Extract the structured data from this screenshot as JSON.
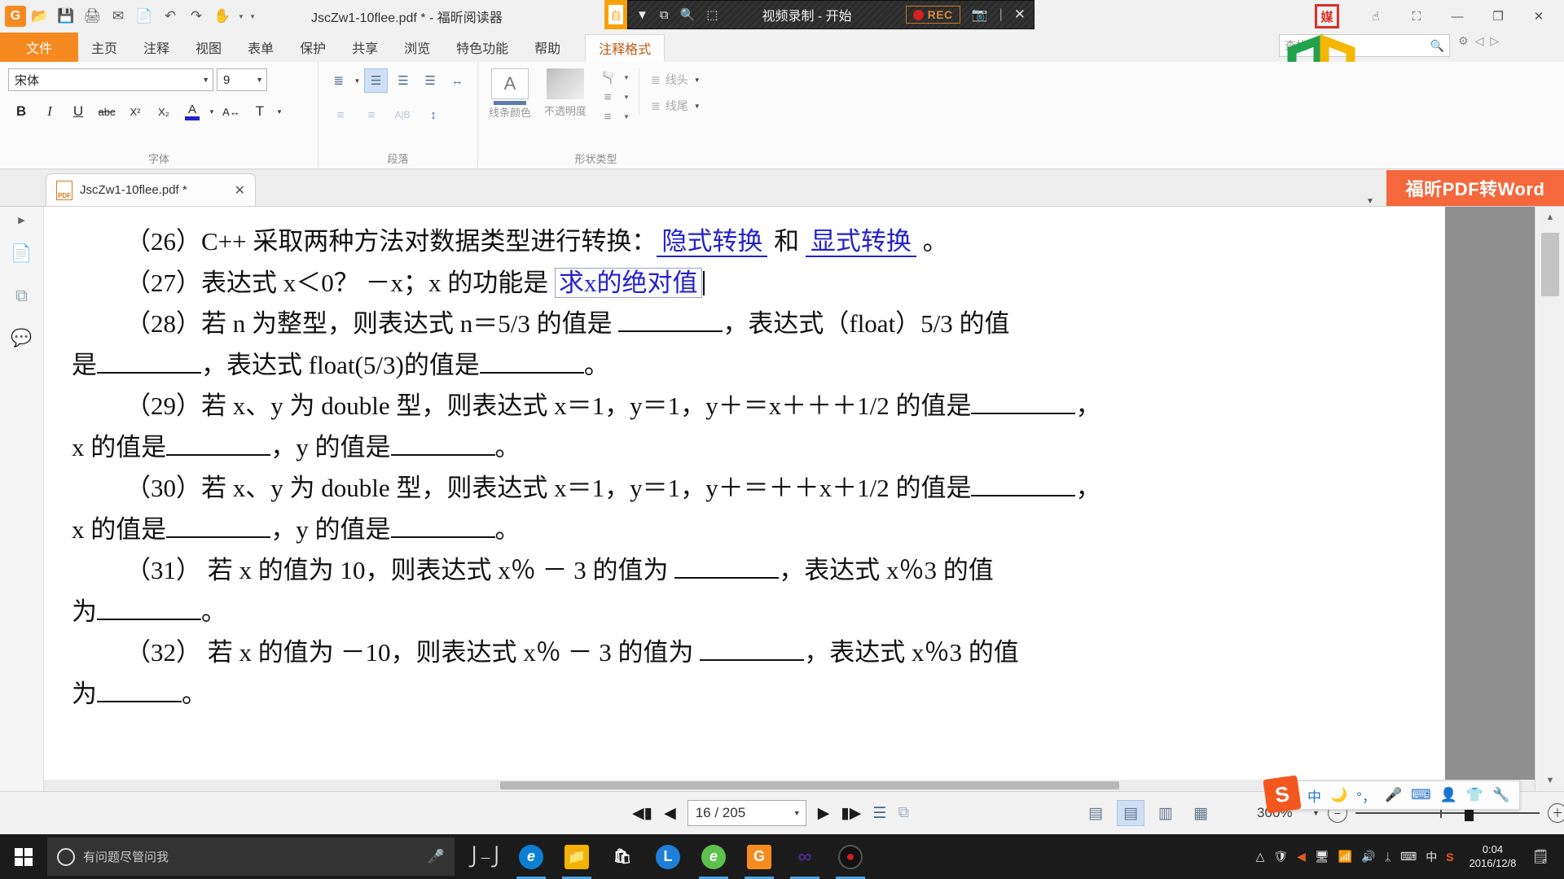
{
  "titlebar": {
    "app_logo": "foxit-logo",
    "document_title": "JscZw1-10flee.pdf * - 福昕阅读器",
    "quick_access": [
      {
        "name": "open-icon",
        "glyph": "📂"
      },
      {
        "name": "save-icon",
        "glyph": "💾"
      },
      {
        "name": "print-icon",
        "glyph": "🖨"
      },
      {
        "name": "email-icon",
        "glyph": "✉"
      },
      {
        "name": "new-blank-icon",
        "glyph": "📄"
      },
      {
        "name": "undo-icon",
        "glyph": "↶"
      },
      {
        "name": "redo-icon",
        "glyph": "↷"
      },
      {
        "name": "hand-tool-icon",
        "glyph": "✋"
      }
    ],
    "amber_chip_label": "自",
    "window_buttons": [
      {
        "name": "touch-mode-icon",
        "glyph": "☝"
      },
      {
        "name": "fullscreen-icon",
        "glyph": "⛶"
      },
      {
        "name": "minimize-icon",
        "glyph": "—"
      },
      {
        "name": "restore-icon",
        "glyph": "❐"
      },
      {
        "name": "close-icon",
        "glyph": "✕"
      }
    ]
  },
  "recorder": {
    "title": "视频录制 - 开始",
    "rec_label": "REC",
    "icons": [
      {
        "name": "dropdown-icon",
        "glyph": "▼"
      },
      {
        "name": "window-select-icon",
        "glyph": "⧉"
      },
      {
        "name": "zoom-region-icon",
        "glyph": "🔍"
      },
      {
        "name": "region-select-icon",
        "glyph": "⬚"
      }
    ],
    "camera_icon": "📷",
    "close_icon": "✕"
  },
  "ribbon": {
    "tabs": [
      {
        "label": "文件",
        "active_file": true
      },
      {
        "label": "主页"
      },
      {
        "label": "注释"
      },
      {
        "label": "视图"
      },
      {
        "label": "表单"
      },
      {
        "label": "保护"
      },
      {
        "label": "共享"
      },
      {
        "label": "浏览"
      },
      {
        "label": "特色功能"
      },
      {
        "label": "帮助"
      }
    ],
    "context_tab": "注释格式",
    "search_placeholder": "查找",
    "groups": {
      "font": {
        "label": "字体",
        "font_name": "宋体",
        "font_size": "9",
        "buttons": [
          {
            "name": "bold-button",
            "glyph": "B"
          },
          {
            "name": "italic-button",
            "glyph": "I"
          },
          {
            "name": "underline-button",
            "glyph": "U"
          },
          {
            "name": "strikethrough-button",
            "glyph": "abc"
          },
          {
            "name": "superscript-button",
            "glyph": "X²"
          },
          {
            "name": "subscript-button",
            "glyph": "X₂"
          },
          {
            "name": "font-color-button",
            "glyph": "A"
          },
          {
            "name": "character-spacing-button",
            "glyph": "A↔"
          },
          {
            "name": "text-direction-button",
            "glyph": "T"
          }
        ]
      },
      "paragraph": {
        "label": "段落",
        "row1": [
          {
            "name": "bullet-list-button",
            "glyph": "≣"
          },
          {
            "name": "align-left-button",
            "glyph": "☰"
          },
          {
            "name": "align-center-button",
            "glyph": "☰"
          },
          {
            "name": "align-right-button",
            "glyph": "☰"
          },
          {
            "name": "justify-button",
            "glyph": "↔"
          }
        ],
        "row2": [
          {
            "name": "decrease-indent-button",
            "glyph": "≡"
          },
          {
            "name": "increase-indent-button",
            "glyph": "≡"
          },
          {
            "name": "text-direction-rtl-button",
            "glyph": "A|B"
          },
          {
            "name": "line-spacing-button",
            "glyph": "↕"
          }
        ]
      },
      "shape": {
        "label": "形状类型",
        "line_color_label": "线条颜色",
        "opacity_label": "不透明度",
        "line_head_label": "线头",
        "line_tail_label": "线尾",
        "line_color_glyph": "A",
        "fill_glyphs": [
          {
            "name": "fill-color-icon",
            "glyph": "🫗"
          },
          {
            "name": "line-style-icon",
            "glyph": "≡"
          },
          {
            "name": "line-weight-icon",
            "glyph": "≡"
          }
        ]
      }
    }
  },
  "doctab": {
    "filename": "JscZw1-10flee.pdf *",
    "pdf_icon_text": "PDF",
    "close_glyph": "✕",
    "overflow_caret": "▼",
    "convert_banner": "福昕PDF转Word"
  },
  "navrail": {
    "expander": "▶",
    "items": [
      {
        "name": "page-thumbnails-icon",
        "glyph": "📄"
      },
      {
        "name": "layers-icon",
        "glyph": "⧉"
      },
      {
        "name": "comments-icon",
        "glyph": "💬"
      }
    ]
  },
  "document": {
    "lines": [
      {
        "id": "q26",
        "indent": true,
        "segments": [
          {
            "t": "（26）C++ 采取两种方法对数据类型进行转换："
          },
          {
            "t": "隐式转换",
            "style": "anno"
          },
          {
            "t": " 和 "
          },
          {
            "t": "显式转换",
            "style": "anno"
          },
          {
            "t": " 。"
          }
        ]
      },
      {
        "id": "q27",
        "indent": true,
        "segments": [
          {
            "t": "（27）表达式 x＜0？ －x；x 的功能是 "
          },
          {
            "t": "求x的绝对值",
            "style": "anno-box"
          },
          {
            "t": "",
            "style": "caret"
          }
        ]
      },
      {
        "id": "q28a",
        "indent": true,
        "segments": [
          {
            "t": "（28）若 n 为整型，则表达式 n＝5/3 的值是 "
          },
          {
            "t": "",
            "style": "blank-lg"
          },
          {
            "t": "，表达式（float）5/3 的值"
          }
        ]
      },
      {
        "id": "q28b",
        "indent": false,
        "segments": [
          {
            "t": "是"
          },
          {
            "t": "",
            "style": "blank-lg"
          },
          {
            "t": "，表达式 float(5/3)的值是"
          },
          {
            "t": "",
            "style": "blank-lg"
          },
          {
            "t": "。"
          }
        ]
      },
      {
        "id": "q29a",
        "indent": true,
        "segments": [
          {
            "t": "（29）若 x、y 为 double 型，则表达式 x＝1，y＝1，y＋＝x＋＋＋1/2 的值是"
          },
          {
            "t": "",
            "style": "blank-lg"
          },
          {
            "t": "，"
          }
        ]
      },
      {
        "id": "q29b",
        "indent": false,
        "segments": [
          {
            "t": "x 的值是"
          },
          {
            "t": "",
            "style": "blank-lg"
          },
          {
            "t": "，y 的值是"
          },
          {
            "t": "",
            "style": "blank-lg"
          },
          {
            "t": "。"
          }
        ]
      },
      {
        "id": "q30a",
        "indent": true,
        "segments": [
          {
            "t": "（30）若 x、y 为 double 型，则表达式 x＝1，y＝1，y＋＝＋＋x＋1/2 的值是"
          },
          {
            "t": "",
            "style": "blank-lg"
          },
          {
            "t": "，"
          }
        ]
      },
      {
        "id": "q30b",
        "indent": false,
        "segments": [
          {
            "t": "x 的值是"
          },
          {
            "t": "",
            "style": "blank-lg"
          },
          {
            "t": "，y 的值是"
          },
          {
            "t": "",
            "style": "blank-lg"
          },
          {
            "t": "。"
          }
        ]
      },
      {
        "id": "q31a",
        "indent": true,
        "segments": [
          {
            "t": "（31） 若 x 的值为 10，则表达式 x％ － 3 的值为 "
          },
          {
            "t": "",
            "style": "blank-lg"
          },
          {
            "t": "，表达式 x％3 的值"
          }
        ]
      },
      {
        "id": "q31b",
        "indent": false,
        "segments": [
          {
            "t": "为"
          },
          {
            "t": "",
            "style": "blank-lg"
          },
          {
            "t": "。"
          }
        ]
      },
      {
        "id": "q32a",
        "indent": true,
        "segments": [
          {
            "t": "（32） 若 x 的值为 －10，则表达式 x％ － 3 的值为 "
          },
          {
            "t": "",
            "style": "blank-lg"
          },
          {
            "t": "，表达式 x％3 的值"
          }
        ]
      },
      {
        "id": "q32b",
        "indent": false,
        "segments": [
          {
            "t": "为"
          },
          {
            "t": "",
            "style": "blank-md"
          },
          {
            "t": "。"
          }
        ]
      }
    ]
  },
  "statusbar": {
    "first_page_glyph": "◀▮",
    "prev_page_glyph": "◀",
    "page_value": "16 / 205",
    "page_caret": "▼",
    "next_page_glyph": "▶",
    "last_page_glyph": "▮▶",
    "extra_icons": [
      {
        "name": "bookmark-panel-icon",
        "glyph": "☰"
      },
      {
        "name": "comment-panel-icon",
        "glyph": "⧉"
      }
    ],
    "view_modes": [
      {
        "name": "single-page-view",
        "glyph": "▤",
        "active": false
      },
      {
        "name": "continuous-view",
        "glyph": "▤",
        "active": true
      },
      {
        "name": "facing-view",
        "glyph": "▥",
        "active": false
      },
      {
        "name": "facing-continuous-view",
        "glyph": "▦",
        "active": false
      }
    ],
    "zoom_value": "300%",
    "zoom_caret": "▼",
    "zoom_out_glyph": "−",
    "zoom_in_glyph": "＋"
  },
  "ime": {
    "logo": "S",
    "items": [
      {
        "name": "ime-chinese-mode-icon",
        "glyph": "中"
      },
      {
        "name": "ime-moon-icon",
        "glyph": "🌙"
      },
      {
        "name": "ime-punctuation-icon",
        "glyph": "°，"
      },
      {
        "name": "ime-voice-input-icon",
        "glyph": "🎤"
      },
      {
        "name": "ime-soft-keyboard-icon",
        "glyph": "⌨"
      },
      {
        "name": "ime-user-icon",
        "glyph": "👤"
      },
      {
        "name": "ime-skin-icon",
        "glyph": "👕"
      },
      {
        "name": "ime-toolbox-icon",
        "glyph": "🔧"
      }
    ]
  },
  "taskbar": {
    "search_placeholder": "有问题尽管问我",
    "mic_glyph": "🎤",
    "task_view_glyph": "▭",
    "apps": [
      {
        "name": "taskbar-edge",
        "glyph": "e",
        "color": "#0b7fd4",
        "open": false
      },
      {
        "name": "taskbar-file-explorer",
        "glyph": "📁",
        "color": "#f2b200",
        "open": true
      },
      {
        "name": "taskbar-store",
        "glyph": "🛍",
        "color": "#ffffff",
        "open": false
      },
      {
        "name": "taskbar-lol",
        "glyph": "L",
        "color": "#1f7fd8",
        "open": false
      },
      {
        "name": "taskbar-browser-360",
        "glyph": "e",
        "color": "#5ec14e",
        "open": true
      },
      {
        "name": "taskbar-foxit-reader",
        "glyph": "G",
        "color": "#f68a20",
        "open": true
      },
      {
        "name": "taskbar-qq",
        "glyph": "∞",
        "color": "#4b2a8c",
        "open": true
      },
      {
        "name": "taskbar-recorder",
        "glyph": "●",
        "color": "#d42020",
        "open": true
      }
    ],
    "tray": [
      {
        "name": "tray-expand-icon",
        "glyph": "⌃"
      },
      {
        "name": "tray-shield-icon",
        "glyph": "🛡"
      },
      {
        "name": "tray-arrow-icon",
        "glyph": "◀"
      },
      {
        "name": "tray-screen-icon",
        "glyph": "🖥"
      },
      {
        "name": "tray-network-icon",
        "glyph": "📶"
      },
      {
        "name": "tray-volume-icon",
        "glyph": "🔊"
      },
      {
        "name": "tray-bluetooth-icon",
        "glyph": "ᛦ"
      },
      {
        "name": "tray-keyboard-icon",
        "glyph": "⌨"
      },
      {
        "name": "tray-ime-icon",
        "glyph": "中"
      },
      {
        "name": "tray-sogou-icon",
        "glyph": "S"
      }
    ],
    "clock_time": "0:04",
    "clock_date": "2016/12/8",
    "notification_glyph": "🗒"
  },
  "colors": {
    "accent_orange": "#f68a20",
    "banner_orange": "#f4683c",
    "annotation_blue": "#2222cc",
    "rec_red": "#d42020",
    "taskbar_dark": "#1b1b1b"
  }
}
